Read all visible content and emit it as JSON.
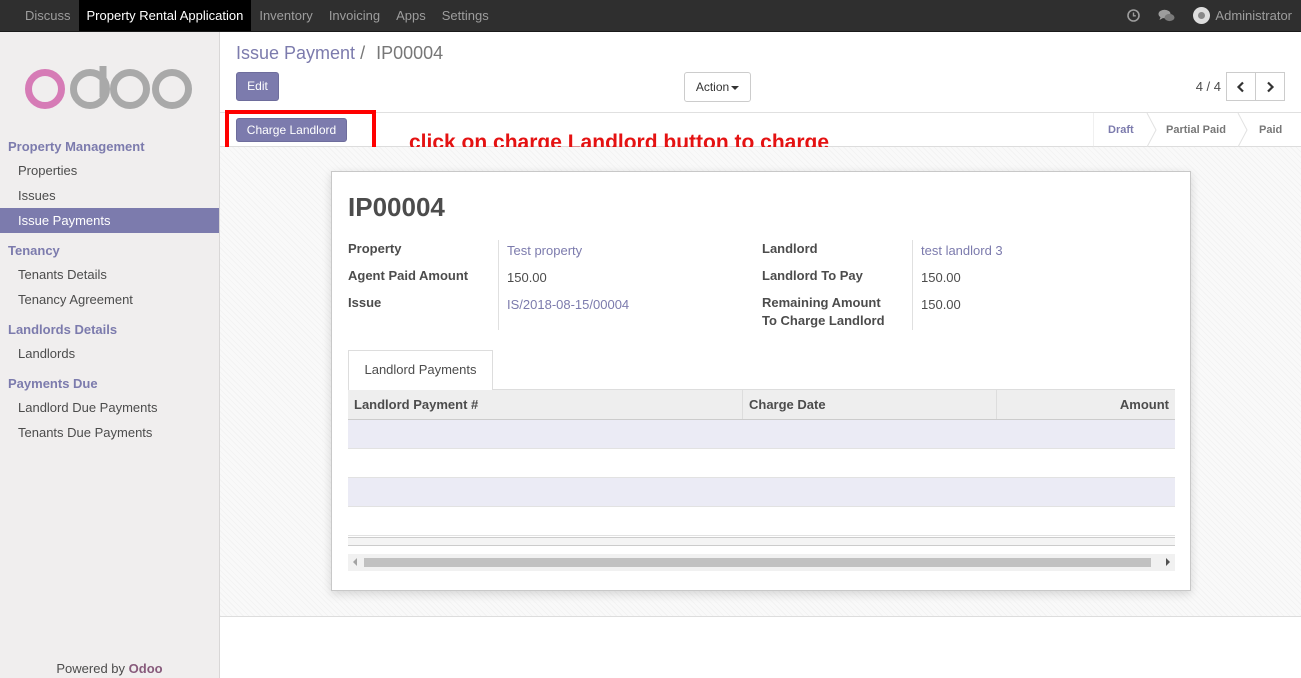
{
  "topbar": {
    "menu": [
      "Discuss",
      "Property Rental Application",
      "Inventory",
      "Invoicing",
      "Apps",
      "Settings"
    ],
    "active_index": 1,
    "user": "Administrator",
    "icons": [
      "clock-icon",
      "chat-icon"
    ]
  },
  "sidebar": {
    "logo_text": "odoo",
    "groups": [
      {
        "title": "Property Management",
        "items": [
          "Properties",
          "Issues",
          "Issue Payments"
        ]
      },
      {
        "title": "Tenancy",
        "items": [
          "Tenants Details",
          "Tenancy Agreement"
        ]
      },
      {
        "title": "Landlords Details",
        "items": [
          "Landlords"
        ]
      },
      {
        "title": "Payments Due",
        "items": [
          "Landlord Due Payments",
          "Tenants Due Payments"
        ]
      }
    ],
    "active_item": "Issue Payments",
    "powered_prefix": "Powered by ",
    "powered_brand": "Odoo"
  },
  "control_panel": {
    "breadcrumb_parent": "Issue Payment",
    "breadcrumb_sep": "/",
    "breadcrumb_current": "IP00004",
    "edit_label": "Edit",
    "action_label": "Action",
    "pager_value": "4 / 4"
  },
  "statusbar": {
    "charge_label": "Charge Landlord",
    "stages": [
      "Draft",
      "Partial Paid",
      "Paid"
    ],
    "current_stage": "Draft"
  },
  "annotation": {
    "text": "click on charge Landlord button to charge"
  },
  "form": {
    "title": "IP00004",
    "left_fields": [
      {
        "label": "Property",
        "value": "Test property",
        "link": true
      },
      {
        "label": "Agent Paid Amount",
        "value": "150.00",
        "link": false
      },
      {
        "label": "Issue",
        "value": "IS/2018-08-15/00004",
        "link": true
      }
    ],
    "right_fields": [
      {
        "label": "Landlord",
        "value": "test landlord 3",
        "link": true
      },
      {
        "label": "Landlord To Pay",
        "value": "150.00",
        "link": false
      },
      {
        "label_line1": "Remaining Amount",
        "label_line2": "To Charge Landlord",
        "value": "150.00",
        "link": false
      }
    ],
    "tab_label": "Landlord Payments",
    "columns": [
      "Landlord Payment #",
      "Charge Date",
      "Amount"
    ],
    "rows": []
  },
  "colors": {
    "accent": "#7c7bad",
    "topbar": "#2f2f2f",
    "annotation": "#ff0000"
  }
}
